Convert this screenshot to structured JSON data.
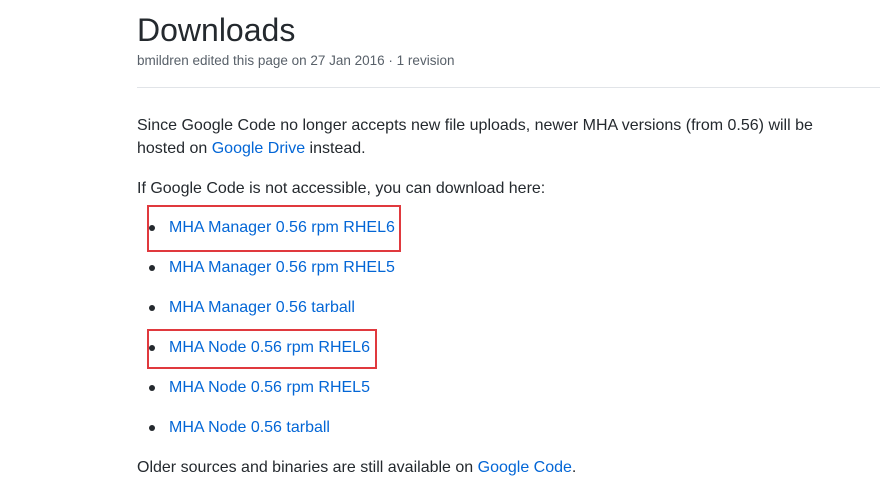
{
  "page": {
    "title": "Downloads",
    "meta": "bmildren edited this page on 27 Jan 2016 · 1 revision"
  },
  "intro": {
    "text_before": "Since Google Code no longer accepts new file uploads, newer MHA versions (from 0.56) will be hosted on ",
    "link": "Google Drive",
    "text_after": " instead."
  },
  "fallback_text": "If Google Code is not accessible, you can download here:",
  "downloads": [
    {
      "label": "MHA Manager 0.56 rpm RHEL6",
      "highlighted": true
    },
    {
      "label": "MHA Manager 0.56 rpm RHEL5",
      "highlighted": false
    },
    {
      "label": "MHA Manager 0.56 tarball",
      "highlighted": false
    },
    {
      "label": "MHA Node 0.56 rpm RHEL6",
      "highlighted": true
    },
    {
      "label": "MHA Node 0.56 rpm RHEL5",
      "highlighted": false
    },
    {
      "label": "MHA Node 0.56 tarball",
      "highlighted": false
    }
  ],
  "footer": {
    "text_before": "Older sources and binaries are still available on ",
    "link": "Google Code",
    "text_after": "."
  },
  "colors": {
    "link": "#0366d6",
    "highlight": "#e0393e",
    "text": "#24292e",
    "muted": "#586069"
  }
}
